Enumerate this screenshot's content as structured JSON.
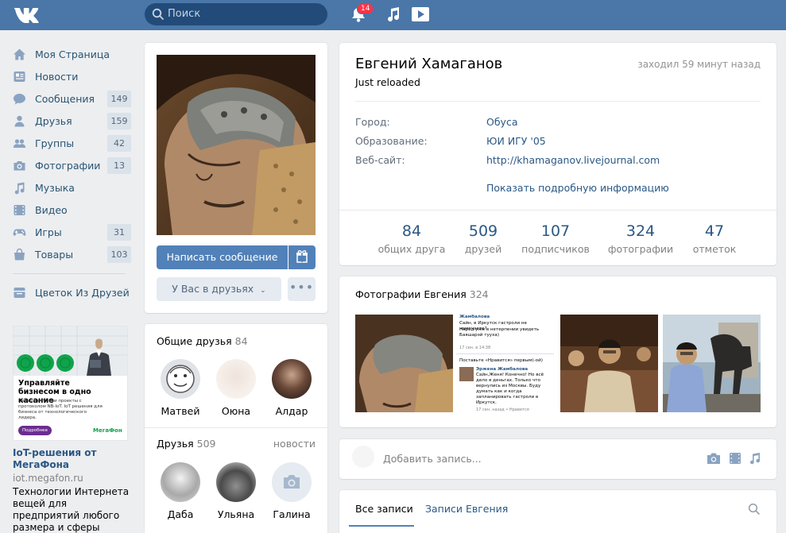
{
  "header": {
    "search_placeholder": "Поиск",
    "notifications_count": "14"
  },
  "nav": {
    "items": [
      {
        "label": "Моя Страница",
        "icon": "home-icon",
        "count": ""
      },
      {
        "label": "Новости",
        "icon": "news-icon",
        "count": ""
      },
      {
        "label": "Сообщения",
        "icon": "messages-icon",
        "count": "149"
      },
      {
        "label": "Друзья",
        "icon": "friends-icon",
        "count": "159"
      },
      {
        "label": "Группы",
        "icon": "groups-icon",
        "count": "42"
      },
      {
        "label": "Фотографии",
        "icon": "camera-icon",
        "count": "13"
      },
      {
        "label": "Музыка",
        "icon": "music-icon",
        "count": ""
      },
      {
        "label": "Видео",
        "icon": "video-icon",
        "count": ""
      },
      {
        "label": "Игры",
        "icon": "gamepad-icon",
        "count": "31"
      },
      {
        "label": "Товары",
        "icon": "bag-icon",
        "count": "103"
      }
    ],
    "extra": {
      "label": "Цветок Из Друзей",
      "icon": "app-icon"
    }
  },
  "ad": {
    "image_text": "Управляйте бизнесом в одно касание",
    "image_subtext": "Первые в России проекты с протоколом NB-IoT. IoT решения для бизнеса от технологического лидера.",
    "image_button": "Подробнее",
    "image_brand": "МегаФон",
    "title": "IoT-решения от МегаФона",
    "domain": "iot.megafon.ru",
    "text": "Технологии Интернета вещей для предприятий любого размера и сферы деятельности"
  },
  "profile": {
    "write_message": "Написать сообщение",
    "friend_status": "У Вас в друзьях",
    "more": "•••"
  },
  "mutual_friends": {
    "title": "Общие друзья",
    "count": "84",
    "people": [
      "Матвей",
      "Оюна",
      "Алдар"
    ]
  },
  "friends": {
    "title": "Друзья",
    "count": "509",
    "link": "новости",
    "people": [
      "Даба",
      "Ульяна",
      "Галина"
    ]
  },
  "info": {
    "name": "Евгений Хамаганов",
    "status": "Just reloaded",
    "last_seen": "заходил 59 минут назад",
    "rows": [
      {
        "label": "Город:",
        "value": "Обуса"
      },
      {
        "label": "Образование:",
        "value": "ЮИ ИГУ '05"
      },
      {
        "label": "Веб-сайт:",
        "value": "http://khamaganov.livejournal.com"
      }
    ],
    "more_info": "Показать подробную информацию",
    "counts": [
      {
        "num": "84",
        "label": "общих друга"
      },
      {
        "num": "509",
        "label": "друзей"
      },
      {
        "num": "107",
        "label": "подписчиков"
      },
      {
        "num": "324",
        "label": "фотографии"
      },
      {
        "num": "47",
        "label": "отметок"
      }
    ]
  },
  "photos": {
    "title": "Фотографии Евгения",
    "count": "324",
    "chat_lines": [
      "Жамбалова",
      "Сайн, в Иркутск гастроли не намечаете?",
      "Народ уже в нетерпении увидеть Баяшарэй тууха)",
      "17 сен. в 14:38",
      "Поставьте «Нравится» первым(-ой)",
      "Эржена Жамбалова",
      "Сайн,Женя! Конечно! Но всё дело в деньгах. Только что вернулись из Москвы. Буду думать как и когда запланировать гастроли в Иркутск.",
      "17 сен. назад • Нравится"
    ]
  },
  "post": {
    "placeholder": "Добавить запись..."
  },
  "wall": {
    "tab_all": "Все записи",
    "tab_owner": "Записи Евгения"
  },
  "colors": {
    "header": "#4a76a8",
    "accent": "#5181b8",
    "link": "#2a5885",
    "background": "#edeef0"
  }
}
